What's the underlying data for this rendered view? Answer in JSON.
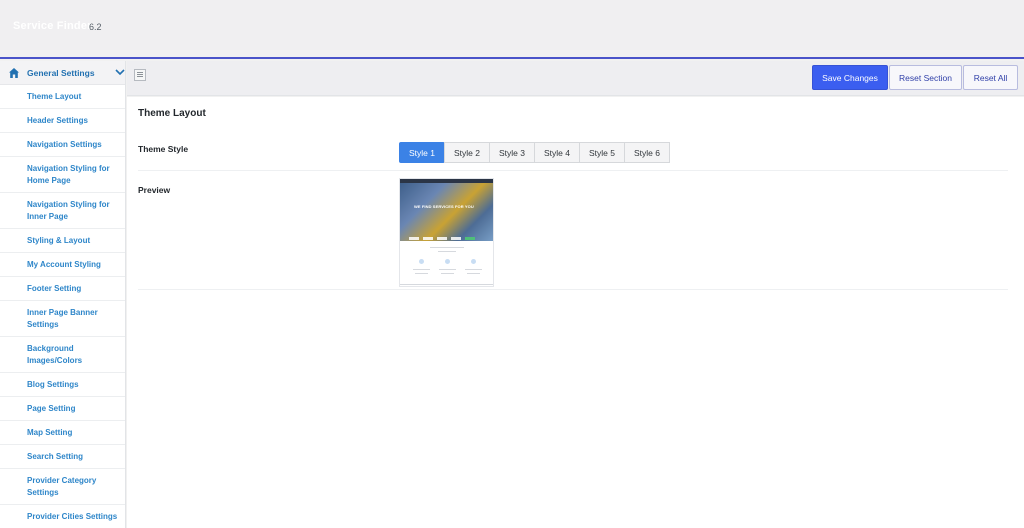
{
  "header": {
    "brand": "Service Finder",
    "version": "6.2"
  },
  "sidebar": {
    "section_title": "General Settings",
    "items": [
      {
        "label": "Theme Layout"
      },
      {
        "label": "Header Settings"
      },
      {
        "label": "Navigation Settings"
      },
      {
        "label": "Navigation Styling for Home Page"
      },
      {
        "label": "Navigation Styling for Inner Page"
      },
      {
        "label": "Styling & Layout"
      },
      {
        "label": "My Account Styling"
      },
      {
        "label": "Footer Setting"
      },
      {
        "label": "Inner Page Banner Settings"
      },
      {
        "label": "Background Images/Colors"
      },
      {
        "label": "Blog Settings"
      },
      {
        "label": "Page Setting"
      },
      {
        "label": "Map Setting"
      },
      {
        "label": "Search Setting"
      },
      {
        "label": "Provider Category Settings"
      },
      {
        "label": "Provider Cities Settings"
      }
    ]
  },
  "toolbar": {
    "save_label": "Save Changes",
    "reset_section_label": "Reset Section",
    "reset_all_label": "Reset All"
  },
  "main": {
    "section_title": "Theme Layout",
    "theme_style_label": "Theme Style",
    "preview_label": "Preview",
    "styles": [
      {
        "label": "Style 1",
        "active": true
      },
      {
        "label": "Style 2",
        "active": false
      },
      {
        "label": "Style 3",
        "active": false
      },
      {
        "label": "Style 4",
        "active": false
      },
      {
        "label": "Style 5",
        "active": false
      },
      {
        "label": "Style 6",
        "active": false
      }
    ],
    "preview_hero_text": "WE FIND SERVICES FOR YOU"
  },
  "colors": {
    "accent": "#3b5ef0",
    "active_style": "#3b82e6",
    "sidebar_link": "#2e86c9",
    "header_rule": "#4a53c9"
  }
}
